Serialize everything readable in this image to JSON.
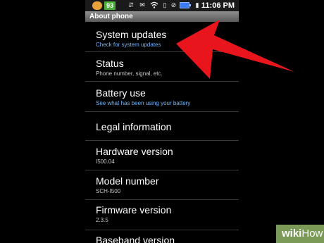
{
  "status_bar": {
    "badge_number": "93",
    "time": "11:06 PM",
    "icons": [
      "notification-badge-icon",
      "wifi-icon",
      "vibrate-icon",
      "no-sound-icon",
      "battery-icon"
    ]
  },
  "header": {
    "title": "About phone"
  },
  "items": [
    {
      "title": "System updates",
      "subtitle": "Check for system updates",
      "subtitle_color": "#6fb6ff"
    },
    {
      "title": "Status",
      "subtitle": "Phone number, signal, etc.",
      "subtitle_color": "#c8c8c8"
    },
    {
      "title": "Battery use",
      "subtitle": "See what has been using your battery",
      "subtitle_color": "#6fb6ff"
    },
    {
      "title": "Legal information",
      "subtitle": ""
    },
    {
      "title": "Hardware version",
      "subtitle": "I500.04"
    },
    {
      "title": "Model number",
      "subtitle": "SCH-I500"
    },
    {
      "title": "Firmware version",
      "subtitle": "2.3.5"
    },
    {
      "title": "Baseband version",
      "subtitle": ""
    }
  ],
  "watermark": {
    "wiki": "wiki",
    "how": "How"
  },
  "colors": {
    "arrow": "#e8161c",
    "watermark_bg": "#7b9a58",
    "header": "#777777"
  }
}
